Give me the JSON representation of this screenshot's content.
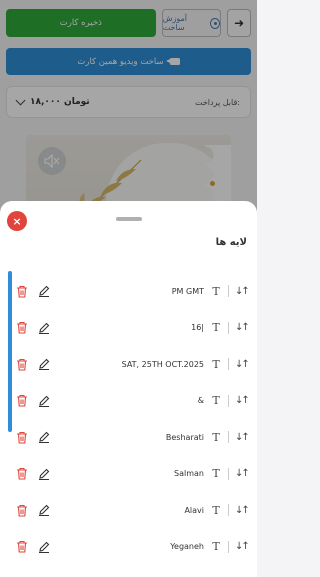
{
  "header": {
    "save_label": "ذخیره کارت",
    "tutorial_label": "آموزش ساخت",
    "back_icon": "arrow-right-icon",
    "video_label": "ساخت ویدیو همین کارت"
  },
  "payment": {
    "label": "قابل پرداخت:",
    "amount": "۱۸,۰۰۰ تومان"
  },
  "sheet": {
    "title": "لایه ها",
    "close_glyph": "×",
    "layers": [
      {
        "name": "PM GMT"
      },
      {
        "name": "16|"
      },
      {
        "name": "SAT, 25TH OCT.2025"
      },
      {
        "name": "&"
      },
      {
        "name": "Besharati"
      },
      {
        "name": "Salman"
      },
      {
        "name": "Alavi"
      },
      {
        "name": "Yeganeh"
      }
    ]
  },
  "colors": {
    "save": "#2eaa3b",
    "video": "#2f8ed6",
    "close": "#e0443c",
    "delete": "#e0443c"
  }
}
